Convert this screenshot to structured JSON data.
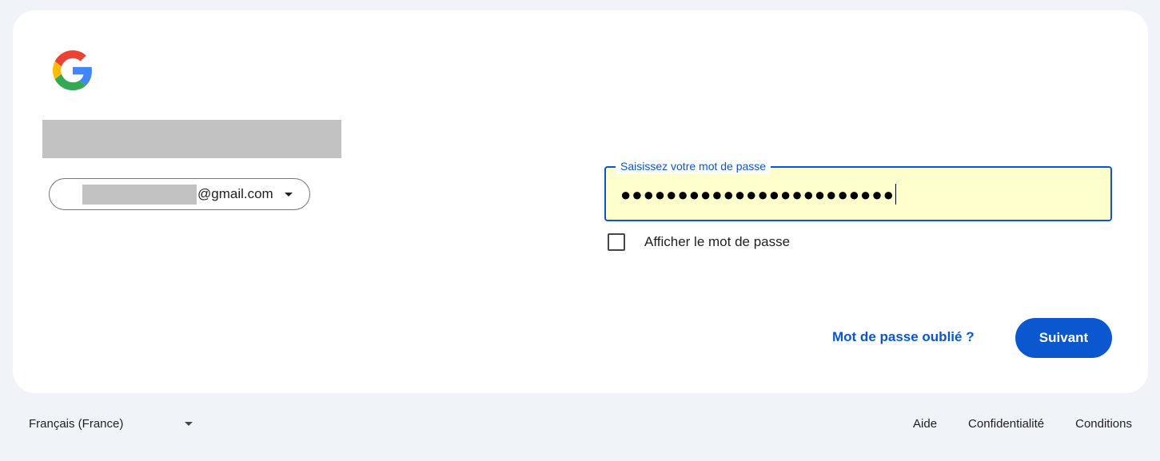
{
  "account": {
    "email_domain": "@gmail.com"
  },
  "password": {
    "label": "Saisissez votre mot de passe",
    "masked_value": "●●●●●●●●●●●●●●●●●●●●●●●●"
  },
  "show_password": {
    "label": "Afficher le mot de passe",
    "checked": false
  },
  "actions": {
    "forgot_label": "Mot de passe oublié ?",
    "next_label": "Suivant"
  },
  "footer": {
    "language": "Français (France)",
    "links": [
      "Aide",
      "Confidentialité",
      "Conditions"
    ]
  },
  "colors": {
    "accent": "#0b57d0",
    "autofill_bg": "#feffcc",
    "page_bg": "#f0f4f9"
  },
  "icons": {
    "logo": "google-g-logo-icon",
    "chip_caret": "caret-down-icon",
    "lang_caret": "caret-down-icon"
  }
}
